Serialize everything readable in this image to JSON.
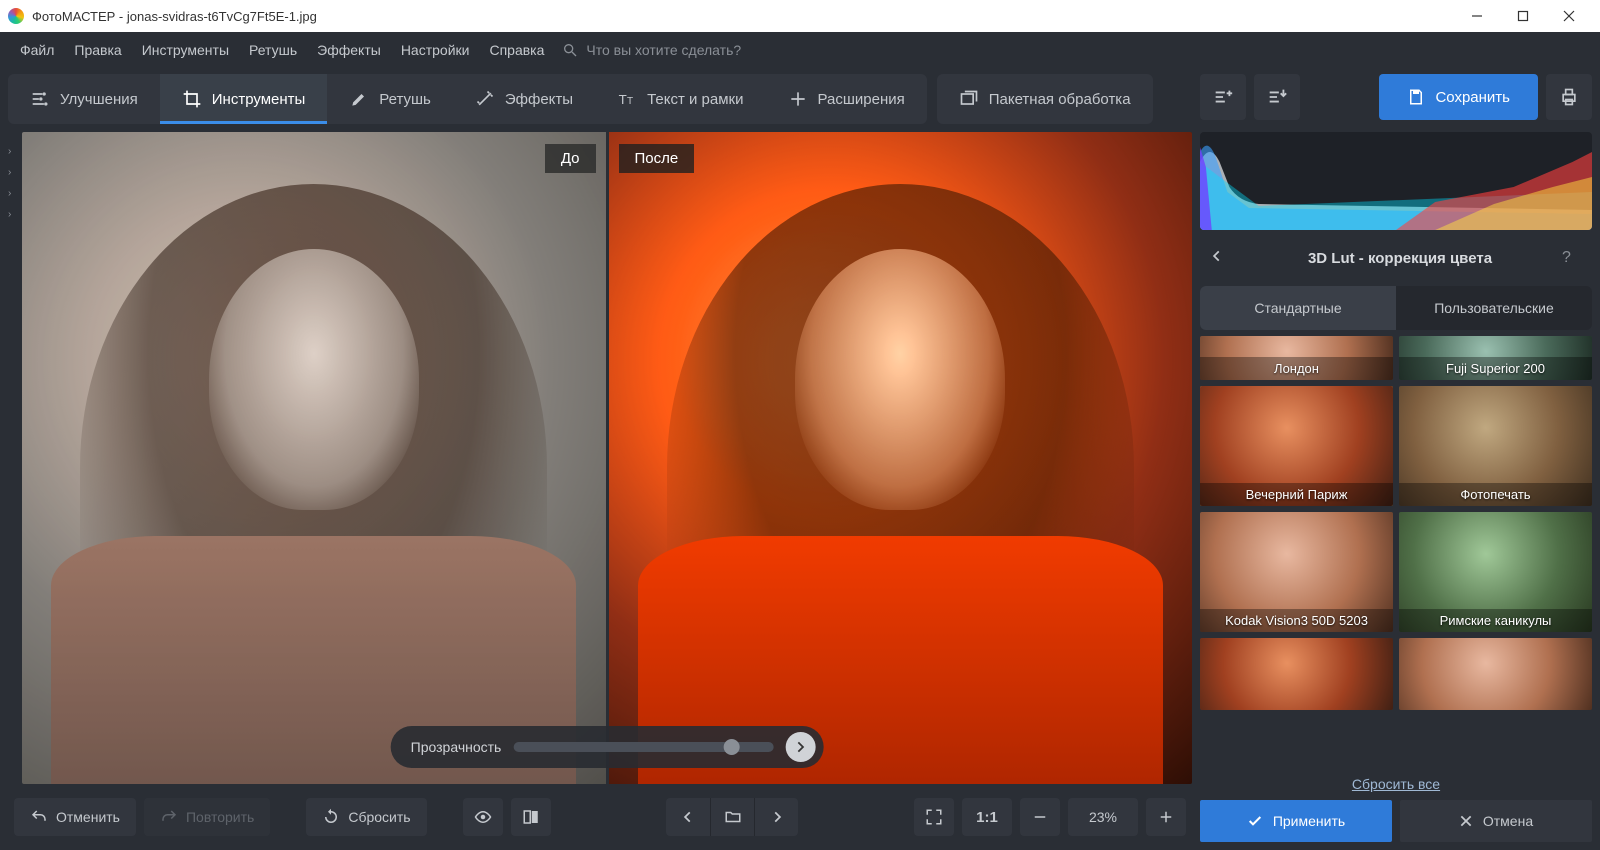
{
  "window": {
    "title": "ФотоМАСТЕР - jonas-svidras-t6TvCg7Ft5E-1.jpg"
  },
  "menu": {
    "items": [
      "Файл",
      "Правка",
      "Инструменты",
      "Ретушь",
      "Эффекты",
      "Настройки",
      "Справка"
    ],
    "search_placeholder": "Что вы хотите сделать?"
  },
  "tabs": {
    "improve": "Улучшения",
    "tools": "Инструменты",
    "retouch": "Ретушь",
    "effects": "Эффекты",
    "text": "Текст и рамки",
    "extensions": "Расширения",
    "batch": "Пакетная обработка"
  },
  "compare": {
    "before": "До",
    "after": "После"
  },
  "slider": {
    "label": "Прозрачность"
  },
  "bottom": {
    "undo": "Отменить",
    "redo": "Повторить",
    "reset": "Сбросить",
    "zoom_ratio": "1:1",
    "zoom_pct": "23%"
  },
  "panel": {
    "save": "Сохранить",
    "section_title": "3D Lut - коррекция цвета",
    "lut_tabs": {
      "standard": "Стандартные",
      "custom": "Пользовательские"
    },
    "presets": [
      {
        "label": "Лондон",
        "style": "soft"
      },
      {
        "label": "Fuji Superior 200",
        "style": "cool"
      },
      {
        "label": "Вечерний Париж",
        "style": "warm",
        "selected": true
      },
      {
        "label": "Фотопечать",
        "style": "sepia"
      },
      {
        "label": "Kodak Vision3 50D 5203",
        "style": "soft"
      },
      {
        "label": "Римские каникулы",
        "style": "green"
      }
    ],
    "reset_all": "Сбросить все",
    "apply": "Применить",
    "cancel": "Отмена"
  }
}
